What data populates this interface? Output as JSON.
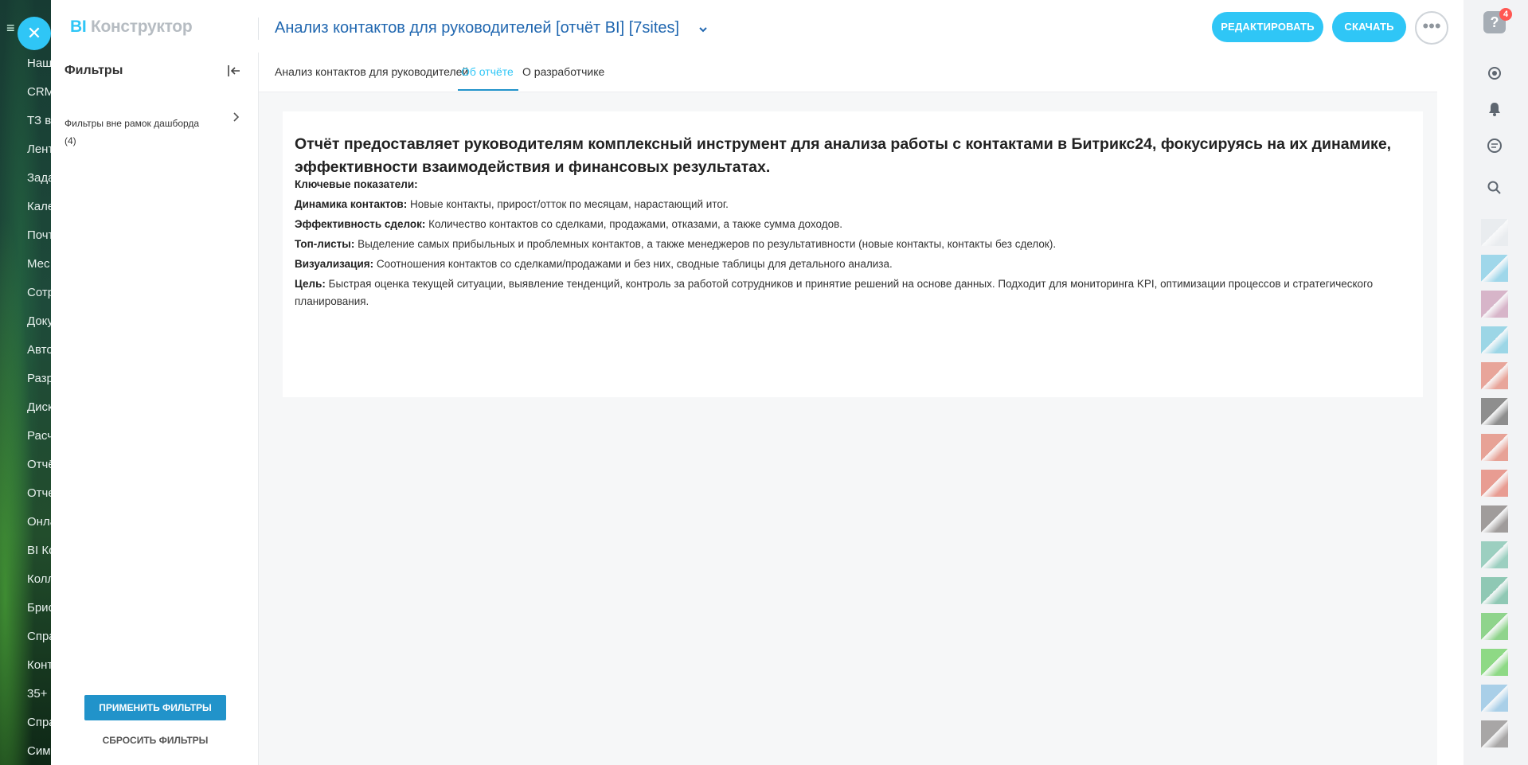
{
  "background_menu": {
    "items": [
      "Наш",
      "CRM",
      "ТЗ в",
      "Лент",
      "Зада",
      "Кале",
      "Почт",
      "Мес",
      "Сотр",
      "Доку",
      "Авто",
      "Разр",
      "Диск",
      "Расч",
      "Отчё",
      "Отче",
      "Онла",
      "BI Ко",
      "Колл",
      "Брис",
      "Спра",
      "Конт",
      "35+",
      "Спра",
      "Сим"
    ]
  },
  "header": {
    "logo_bi": "BI",
    "logo_rest": "Конструктор",
    "report_title": "Анализ контактов для руководителей [отчёт BI] [7sites]",
    "edit_label": "РЕДАКТИРОВАТЬ",
    "download_label": "СКАЧАТЬ",
    "more_label": "•••"
  },
  "filters": {
    "title": "Фильтры",
    "group_label": "Фильтры вне рамок дашборда",
    "group_count": "(4)",
    "apply_label": "ПРИМЕНИТЬ ФИЛЬТРЫ",
    "reset_label": "СБРОСИТЬ ФИЛЬТРЫ"
  },
  "tabs": [
    {
      "label": "Анализ контактов для руководителей",
      "active": false
    },
    {
      "label": "Об отчёте",
      "active": true
    },
    {
      "label": "О разработчике",
      "active": false
    }
  ],
  "report": {
    "heading": "Отчёт предоставляет руководителям комплексный инструмент для анализа работы с контактами в Битрикс24, фокусируясь на их динамике, эффективности взаимодействия и финансовых результатах.",
    "key_label": "Ключевые показатели:",
    "lines": [
      {
        "term": "Динамика контактов:",
        "text": " Новые контакты, прирост/отток по месяцам, нарастающий итог."
      },
      {
        "term": "Эффективность сделок:",
        "text": " Количество контактов со сделками, продажами, отказами, а также сумма доходов."
      },
      {
        "term": "Топ-листы:",
        "text": " Выделение самых прибыльных и проблемных контактов, а также менеджеров по результативности (новые контакты, контакты без сделок)."
      },
      {
        "term": "Визуализация:",
        "text": " Соотношения контактов со сделками/продажами и без них, сводные таблицы для детального анализа."
      },
      {
        "term": "Цель:",
        "text": " Быстрая оценка текущей ситуации, выявление тенденций, контроль за работой сотрудников и принятие решений на основе данных. Подходит для мониторинга KPI, оптимизации процессов и стратегического планирования."
      }
    ]
  },
  "right_rail": {
    "help_badge": "4",
    "icons": [
      "help-icon",
      "sync-icon",
      "bell-icon",
      "chat-icon",
      "search-icon"
    ],
    "avatar_colors": [
      "#e9ecef",
      "#9fd7ea",
      "#d7b5c9",
      "#9cd6e6",
      "#e8a59a",
      "#8e8e8e",
      "#e7a296",
      "#e89c92",
      "#a09c9b",
      "#9ccfc0",
      "#8fc8b4",
      "#8fd48c",
      "#8ed985",
      "#a9cfe8",
      "#a8a6a6"
    ]
  }
}
